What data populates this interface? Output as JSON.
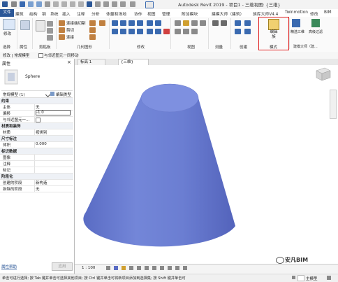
{
  "app": {
    "title": "Autodesk Revit 2019 - 项目1 - 三维视图: {三维}"
  },
  "menu": {
    "file": "文件",
    "items": [
      "建筑",
      "结构",
      "钢",
      "系统",
      "插入",
      "注释",
      "分析",
      "体量和场地",
      "协作",
      "视图",
      "管理",
      "附加模块",
      "建模大师（建筑）",
      "族库大师V4.4",
      "Twinmotion",
      "修改",
      "BIM"
    ]
  },
  "ribbon": {
    "modify_label": "修改",
    "connect_cut_label": "连接端切割",
    "cut_label": "剪切",
    "join_label": "连接",
    "panels": [
      "选择",
      "属性",
      "剪贴板",
      "几何图形",
      "修改",
      "视图",
      "测量",
      "创建",
      "模式",
      "建模大师（建..."
    ],
    "edit_family_label": "编辑族",
    "select_label": "精选三维",
    "advanced_filter_label": "高级过滤"
  },
  "options_bar": {
    "modify_label": "修改 | 常规模型",
    "checkbox_label": "与邻近图元一同移动"
  },
  "properties": {
    "title": "属性",
    "type_name": "Sphere",
    "type_selector": "常规模型 (1)",
    "edit_type": "编辑类型",
    "rows": [
      {
        "name": "约束",
        "value": "",
        "header": true
      },
      {
        "name": "主体",
        "value": "无"
      },
      {
        "name": "偏移",
        "value": "-1.0"
      },
      {
        "name": "与邻近图元一...",
        "value": ""
      },
      {
        "name": "材质和装饰",
        "value": "",
        "header": true
      },
      {
        "name": "材质",
        "value": "按类别"
      },
      {
        "name": "尺寸标注",
        "value": "",
        "header": true
      },
      {
        "name": "体积",
        "value": "0.000"
      },
      {
        "name": "标识数据",
        "value": "",
        "header": true
      },
      {
        "name": "图像",
        "value": ""
      },
      {
        "name": "注释",
        "value": ""
      },
      {
        "name": "标记",
        "value": ""
      },
      {
        "name": "阶段化",
        "value": "",
        "header": true
      },
      {
        "name": "创建的阶段",
        "value": "新构造"
      },
      {
        "name": "拆除的阶段",
        "value": "无"
      }
    ],
    "help_link": "属性帮助",
    "apply_button": "应用"
  },
  "tabs": [
    {
      "label": "标高 1"
    },
    {
      "label": "{三维}"
    }
  ],
  "view_control": {
    "scale": "1 : 100"
  },
  "status_bar": {
    "text": "单击可进行选择; 按 Tab 键并单击可选择其他项目; 按 Ctrl 键并单击可将新项目添加到选择集; 按 Shift 键并单击可",
    "model": "主模型"
  },
  "watermark": "安凡BIM",
  "colors": {
    "accent": "#2b5797",
    "highlight_box": "#e02020",
    "cone_top": "#7e90e0",
    "cone_side": "#6d80d4"
  }
}
